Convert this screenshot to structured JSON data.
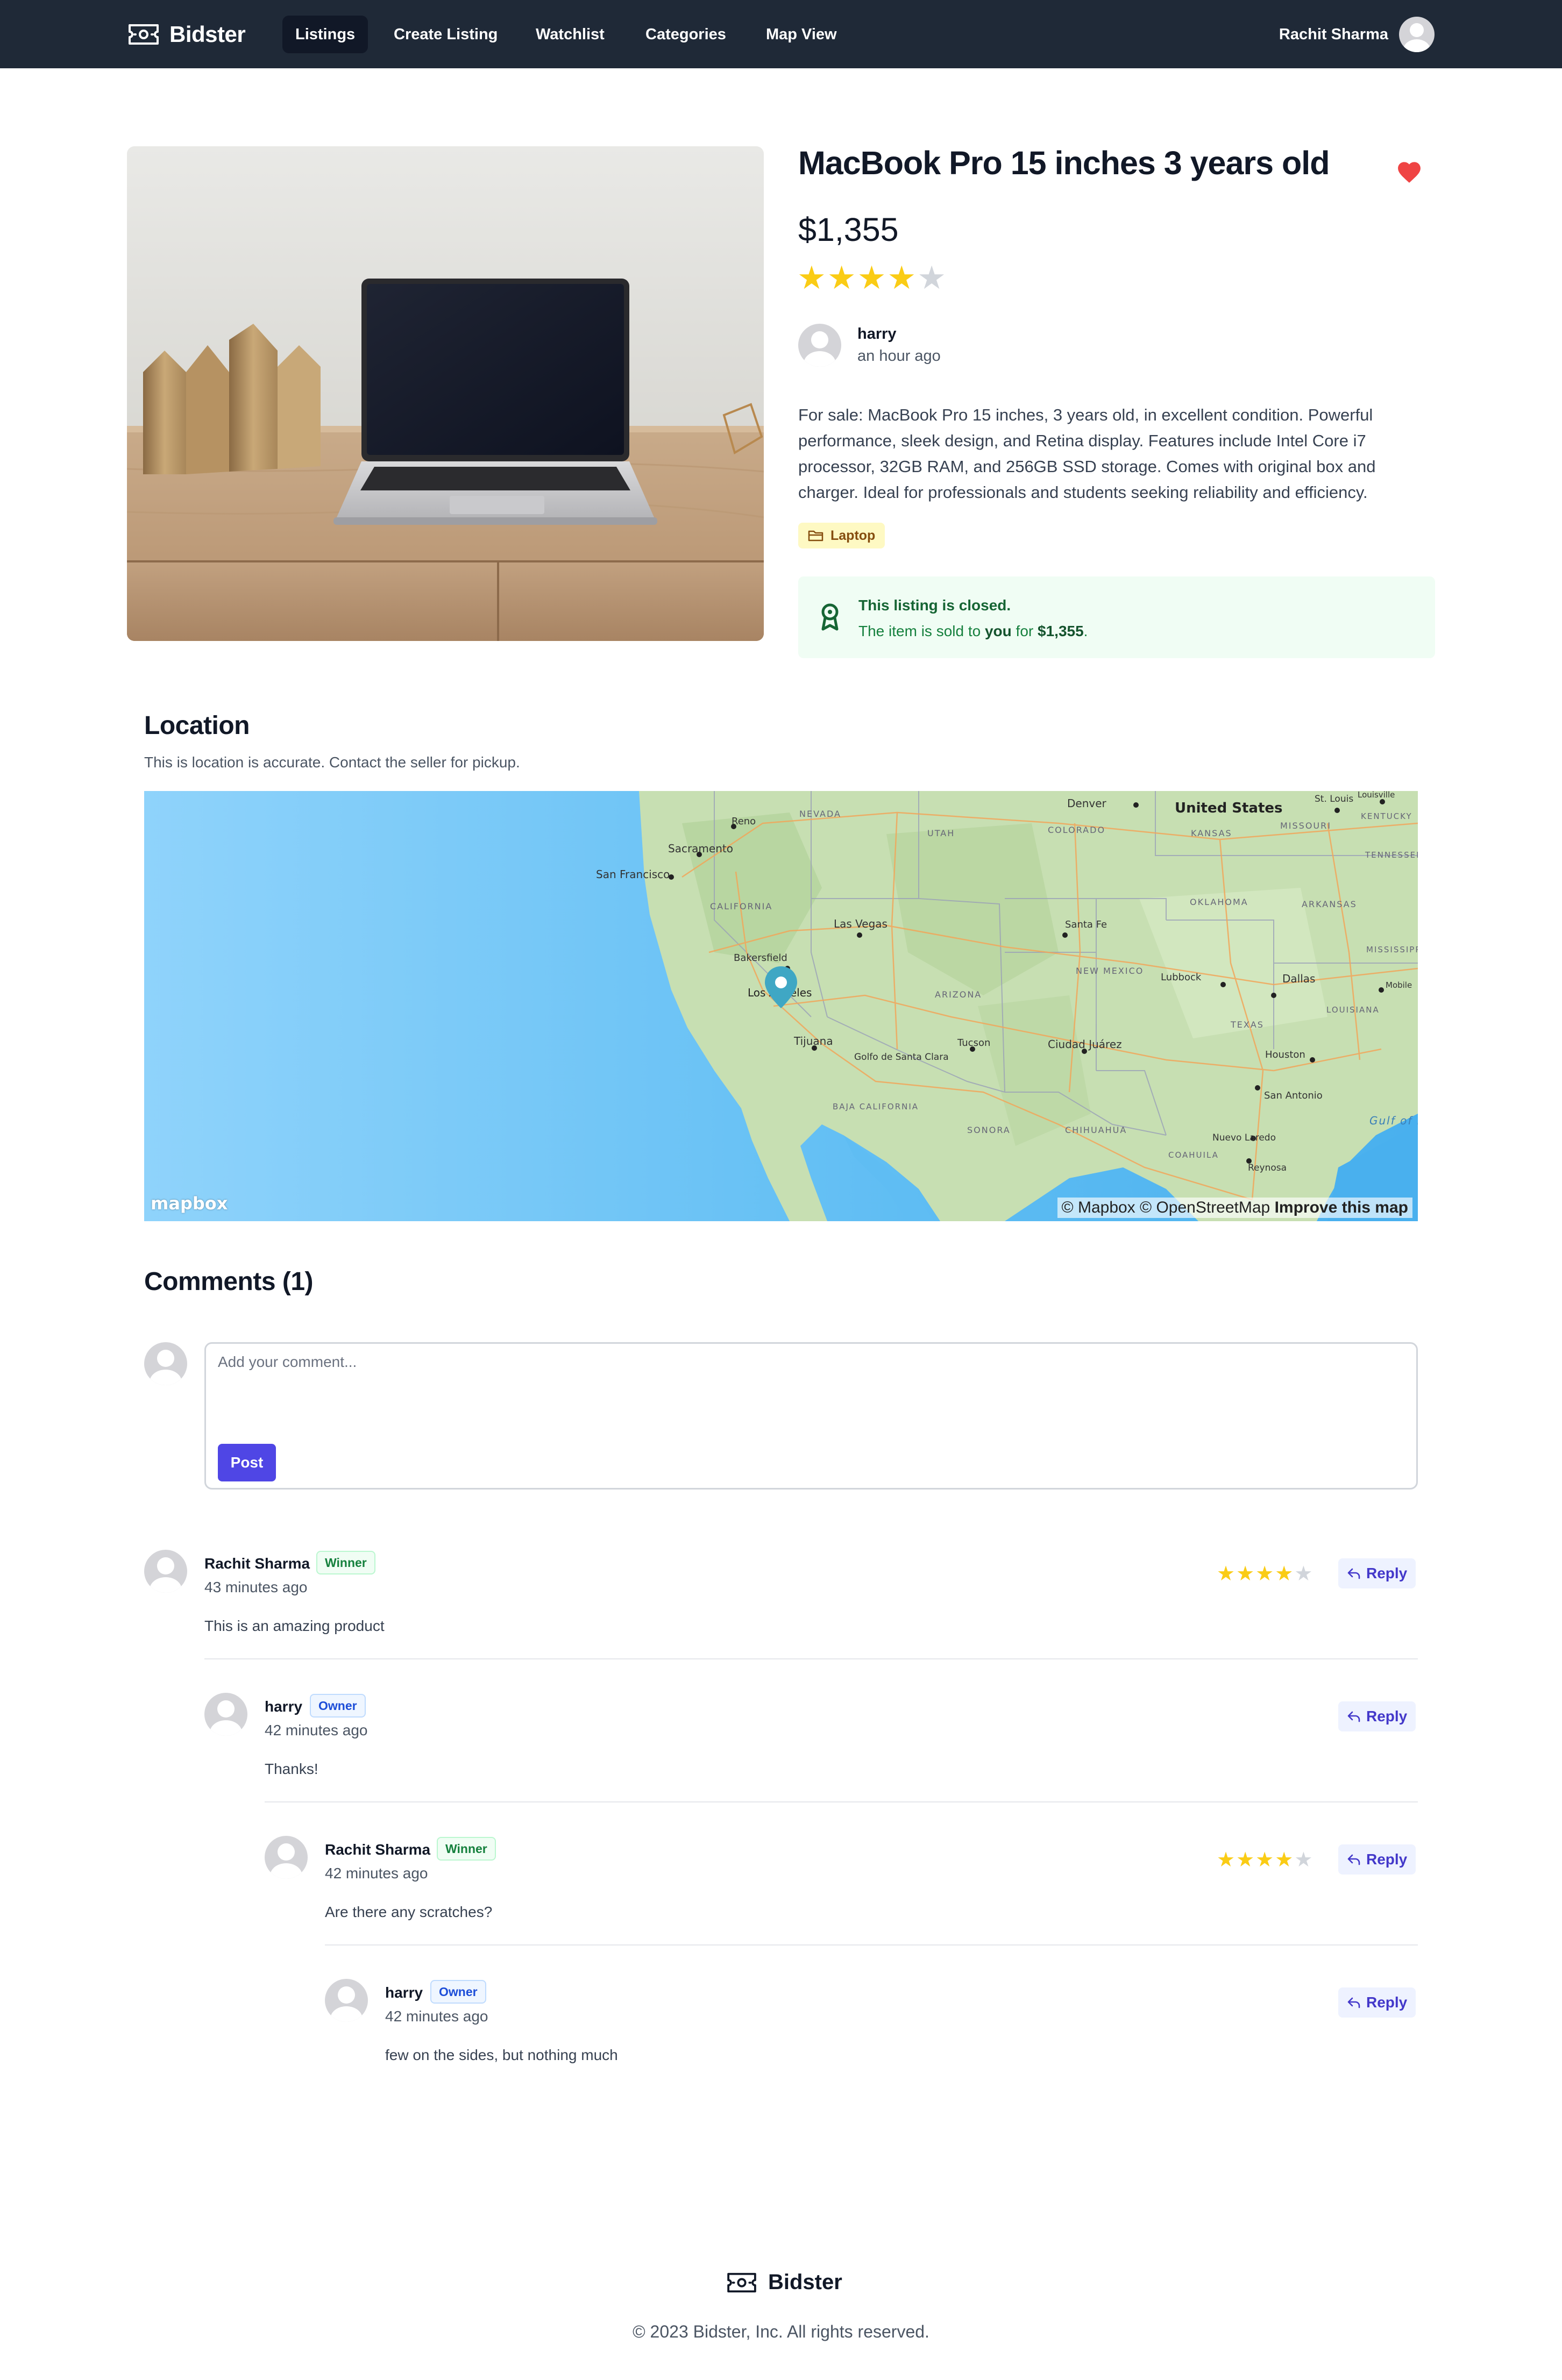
{
  "nav": {
    "brand": "Bidster",
    "links": [
      "Listings",
      "Create Listing",
      "Watchlist",
      "Categories",
      "Map View"
    ],
    "active": "Listings",
    "user_name": "Rachit Sharma"
  },
  "listing": {
    "title": "MacBook Pro 15 inches 3 years old",
    "price": "$1,355",
    "rating": 4,
    "rating_max": 5,
    "watchlisted": true,
    "seller_name": "harry",
    "seller_time": "an hour ago",
    "description": "For sale: MacBook Pro 15 inches, 3 years old, in excellent condition. Powerful performance, sleek design, and Retina display. Features include Intel Core i7 processor, 32GB RAM, and 256GB SSD storage. Comes with original box and charger. Ideal for professionals and students seeking reliability and efficiency.",
    "category": "Laptop",
    "closed_title": "This listing is closed.",
    "closed_prefix": "The item is sold to",
    "closed_buyer": "you",
    "closed_for": "for",
    "closed_amount": "$1,355",
    "closed_suffix": "."
  },
  "location": {
    "heading": "Location",
    "subtitle": "This is location is accurate. Contact the seller for pickup.",
    "map_labels": [
      "United States",
      "Denver",
      "St. Louis",
      "Louisville",
      "Reno",
      "NEVADA",
      "UTAH",
      "COLORADO",
      "KANSAS",
      "MISSOURI",
      "KENTUCKY",
      "Sacramento",
      "San Francisco",
      "TENNESSEE",
      "CALIFORNIA",
      "Las Vegas",
      "Santa Fe",
      "OKLAHOMA",
      "ARKANSAS",
      "Bakersfield",
      "NEW MEXICO",
      "Lubbock",
      "MISSISSIPPI",
      "Los Angeles",
      "ARIZONA",
      "Dallas",
      "Mobile",
      "LOUISIANA",
      "TEXAS",
      "Tijuana",
      "Tucson",
      "Ciudad Juárez",
      "Golfo de Santa Clara",
      "Houston",
      "BAJA CALIFORNIA",
      "San Antonio",
      "SONORA",
      "CHIHUAHUA",
      "Gulf of Mexico",
      "Nuevo Laredo",
      "COAHUILA",
      "Reynosa"
    ],
    "attribution": "© Mapbox © OpenStreetMap",
    "improve": "Improve this map",
    "logo": "mapbox"
  },
  "comments_section": {
    "heading": "Comments (1)",
    "placeholder": "Add your comment...",
    "post_label": "Post",
    "reply_label": "Reply",
    "items": [
      {
        "name": "Rachit Sharma",
        "badge": "Winner",
        "time": "43 minutes ago",
        "text": "This is an amazing product",
        "rating": 4
      },
      {
        "name": "harry",
        "badge": "Owner",
        "time": "42 minutes ago",
        "text": "Thanks!"
      },
      {
        "name": "Rachit Sharma",
        "badge": "Winner",
        "time": "42 minutes ago",
        "text": "Are there any scratches?",
        "rating": 4
      },
      {
        "name": "harry",
        "badge": "Owner",
        "time": "42 minutes ago",
        "text": "few on the sides, but nothing much"
      }
    ]
  },
  "footer": {
    "brand": "Bidster",
    "copyright": "© 2023 Bidster, Inc. All rights reserved."
  },
  "colors": {
    "nav_bg": "#1f2937",
    "accent": "#4f46e5",
    "star": "#facc15",
    "heart": "#ef4444",
    "closed_bg": "#f0fdf4"
  },
  "icons": {
    "brand": "ticket-money-icon",
    "heart": "heart-icon",
    "tag": "folder-icon",
    "closed": "award-ribbon-icon",
    "reply": "reply-arrow-icon",
    "map_pin": "map-pin-icon"
  }
}
